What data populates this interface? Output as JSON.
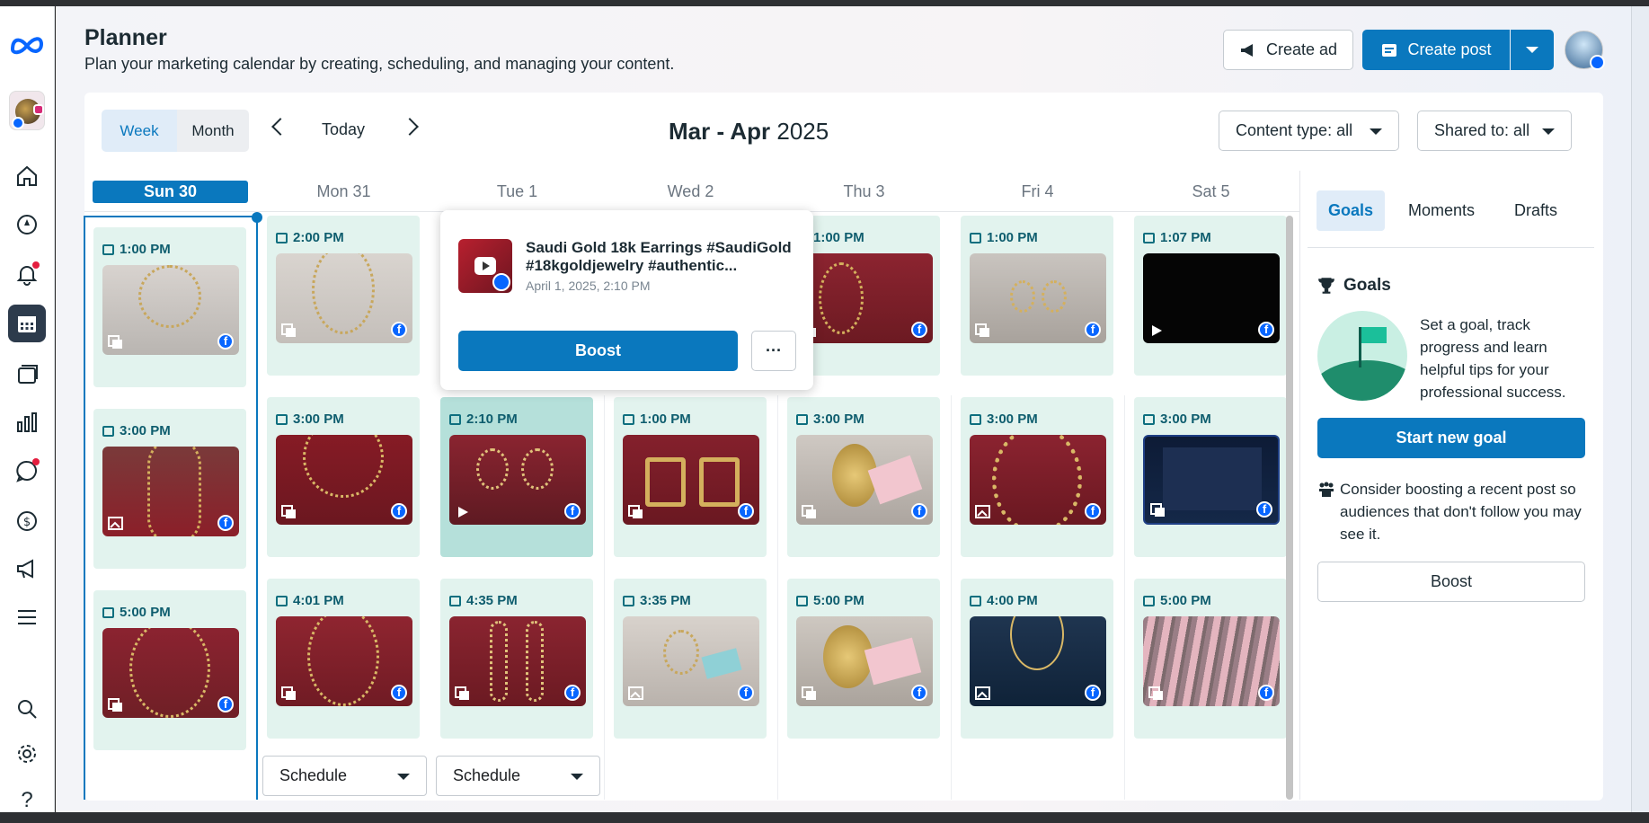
{
  "header": {
    "title": "Planner",
    "subtitle": "Plan your marketing calendar by creating, scheduling, and managing your content.",
    "create_ad": "Create ad",
    "create_post": "Create post"
  },
  "toolbar": {
    "week": "Week",
    "month": "Month",
    "today": "Today",
    "range_months": "Mar - Apr",
    "range_year": "2025",
    "content_type": "Content type: all",
    "shared_to": "Shared to: all"
  },
  "days": [
    "Sun 30",
    "Mon 31",
    "Tue 1",
    "Wed 2",
    "Thu 3",
    "Fri 4",
    "Sat 5"
  ],
  "posts": {
    "sun": [
      "1:00 PM",
      "3:00 PM",
      "5:00 PM"
    ],
    "mon": [
      "2:00 PM",
      "3:00 PM",
      "4:01 PM"
    ],
    "tue": [
      "2:10 PM",
      "4:35 PM"
    ],
    "wed": [
      "1:00 PM",
      "3:35 PM"
    ],
    "thu": [
      "1:00 PM",
      "3:00 PM",
      "5:00 PM"
    ],
    "fri": [
      "1:00 PM",
      "3:00 PM",
      "4:00 PM"
    ],
    "sat": [
      "1:07 PM",
      "3:00 PM",
      "5:00 PM"
    ]
  },
  "popover": {
    "title": "Saudi Gold 18k Earrings #SaudiGold #18kgoldjewelry #authentic...",
    "date": "April 1, 2025, 2:10 PM",
    "boost": "Boost",
    "more": "···"
  },
  "schedule_label": "Schedule",
  "side": {
    "tabs": [
      "Goals",
      "Moments",
      "Drafts"
    ],
    "goals_heading": "Goals",
    "goals_text": "Set a goal, track progress and learn helpful tips for your professional success.",
    "start_goal": "Start new goal",
    "boost_text": "Consider boosting a recent post so audiences that don't follow you may see it.",
    "boost": "Boost"
  },
  "nav_help": "?",
  "colors": {
    "accent": "#0a78be",
    "post_bg": "#e2f3ee",
    "post_selected": "#b5e0da",
    "time_text": "#0e5d6e",
    "nav_active": "#2d3b4c"
  }
}
